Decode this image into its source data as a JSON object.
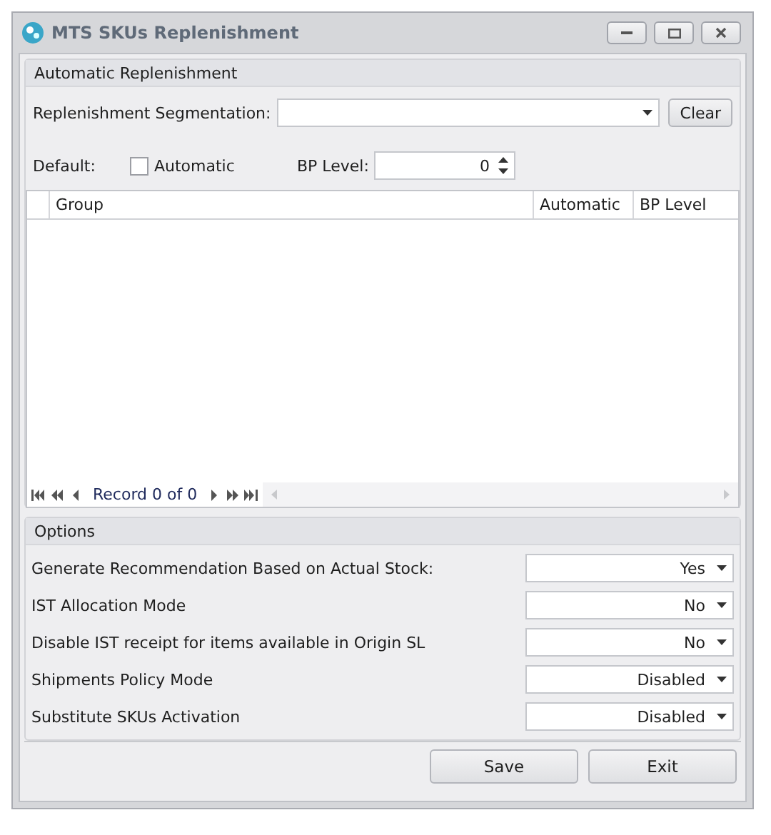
{
  "window": {
    "title": "MTS SKUs Replenishment"
  },
  "automatic_replenishment": {
    "title": "Automatic Replenishment",
    "segmentation_label": "Replenishment Segmentation:",
    "clear_button": "Clear",
    "default_label": "Default:",
    "automatic_checkbox": {
      "label": "Automatic",
      "checked": false
    },
    "bp_level_label": "BP Level:",
    "bp_level_value": "0"
  },
  "grid": {
    "columns": [
      "Group",
      "Automatic",
      "BP Level"
    ],
    "record_text": "Record 0 of 0"
  },
  "options": {
    "title": "Options",
    "rows": [
      {
        "label": "Generate Recommendation Based on Actual Stock:",
        "value": "Yes"
      },
      {
        "label": "IST Allocation Mode",
        "value": "No"
      },
      {
        "label": "Disable IST receipt for items available in Origin SL",
        "value": "No"
      },
      {
        "label": "Shipments Policy Mode",
        "value": "Disabled"
      },
      {
        "label": "Substitute SKUs Activation",
        "value": "Disabled"
      }
    ]
  },
  "buttons": [
    "Save",
    "Exit"
  ]
}
